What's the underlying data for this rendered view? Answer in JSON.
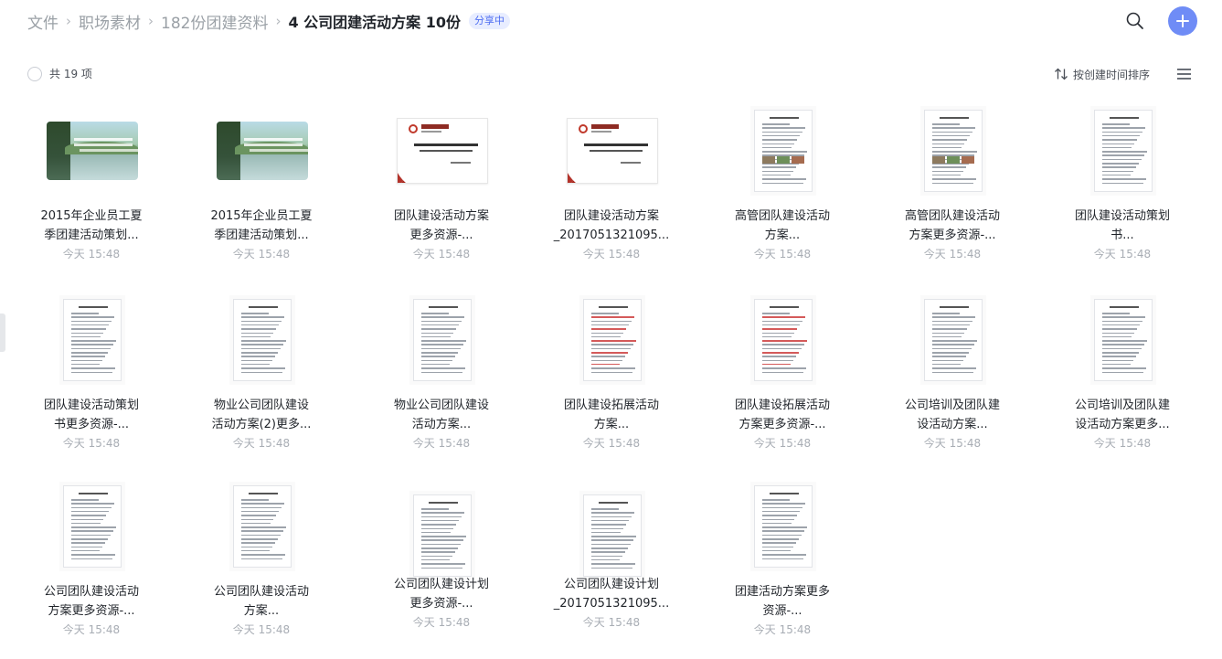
{
  "breadcrumb": {
    "items": [
      "文件",
      "职场素材",
      "182份团建资料"
    ],
    "separator": "›",
    "current": "4 公司团建活动方案 10份",
    "badge": "分享中"
  },
  "toolbar": {
    "count_text": "共 19 项",
    "sort_label": "按创建时间排序"
  },
  "icons": {
    "search": "search-icon",
    "add": "plus-icon",
    "sort": "sort-arrows-icon",
    "view": "list-view-icon"
  },
  "colors": {
    "accent": "#6f8cf6",
    "badge_text": "#4e6ef2",
    "badge_bg": "#e8edff"
  },
  "files": [
    {
      "line1": "2015年企业员工夏",
      "line2": "季团建活动策划...",
      "time": "今天 15:48",
      "thumb": "lake"
    },
    {
      "line1": "2015年企业员工夏",
      "line2": "季团建活动策划...",
      "time": "今天 15:48",
      "thumb": "lake"
    },
    {
      "line1": "团队建设活动方案",
      "line2": "更多资源-...",
      "time": "今天 15:48",
      "thumb": "slide"
    },
    {
      "line1": "团队建设活动方案",
      "line2": "_2017051321095...",
      "time": "今天 15:48",
      "thumb": "slide"
    },
    {
      "line1": "高管团队建设活动",
      "line2": "方案...",
      "time": "今天 15:48",
      "thumb": "doc-photo"
    },
    {
      "line1": "高管团队建设活动",
      "line2": "方案更多资源-...",
      "time": "今天 15:48",
      "thumb": "doc-photo"
    },
    {
      "line1": "团队建设活动策划",
      "line2": "书...",
      "time": "今天 15:48",
      "thumb": "doc"
    },
    {
      "line1": "团队建设活动策划",
      "line2": "书更多资源-...",
      "time": "今天 15:48",
      "thumb": "doc"
    },
    {
      "line1": "物业公司团队建设",
      "line2": "活动方案(2)更多...",
      "time": "今天 15:48",
      "thumb": "doc"
    },
    {
      "line1": "物业公司团队建设",
      "line2": "活动方案...",
      "time": "今天 15:48",
      "thumb": "doc"
    },
    {
      "line1": "团队建设拓展活动",
      "line2": "方案...",
      "time": "今天 15:48",
      "thumb": "doc-red"
    },
    {
      "line1": "团队建设拓展活动",
      "line2": "方案更多资源-...",
      "time": "今天 15:48",
      "thumb": "doc-red"
    },
    {
      "line1": "公司培训及团队建",
      "line2": "设活动方案...",
      "time": "今天 15:48",
      "thumb": "doc"
    },
    {
      "line1": "公司培训及团队建",
      "line2": "设活动方案更多...",
      "time": "今天 15:48",
      "thumb": "doc"
    },
    {
      "line1": "公司团队建设活动",
      "line2": "方案更多资源-...",
      "time": "今天 15:48",
      "thumb": "doc"
    },
    {
      "line1": "公司团队建设活动",
      "line2": "方案...",
      "time": "今天 15:48",
      "thumb": "doc"
    },
    {
      "line1": "公司团队建设计划",
      "line2": "更多资源-...",
      "time": "今天 15:48",
      "thumb": "doc"
    },
    {
      "line1": "公司团队建设计划",
      "line2": "_2017051321095...",
      "time": "今天 15:48",
      "thumb": "doc"
    },
    {
      "line1": "团建活动方案更多",
      "line2": "资源-...",
      "time": "今天 15:48",
      "thumb": "doc"
    }
  ]
}
